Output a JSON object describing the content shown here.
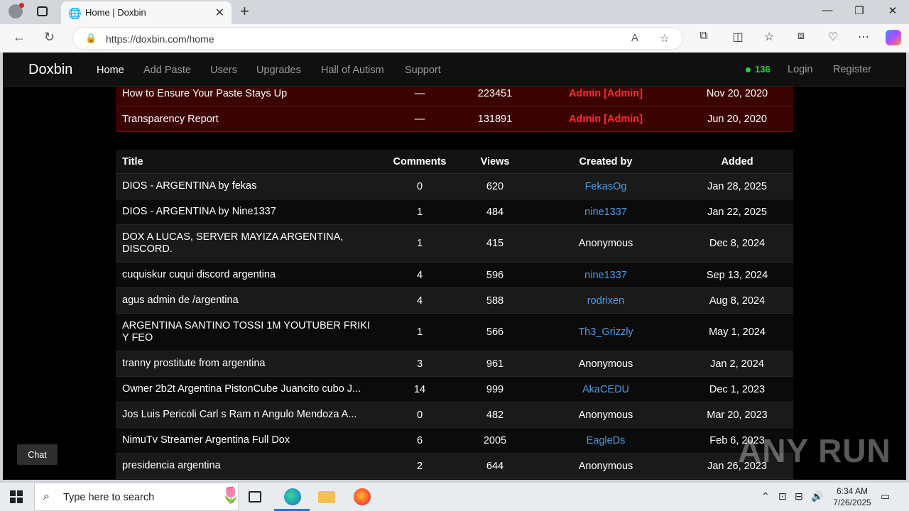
{
  "browser": {
    "tab_title": "Home | Doxbin",
    "url": "https://doxbin.com/home"
  },
  "site": {
    "brand": "Doxbin",
    "nav": [
      "Home",
      "Add Paste",
      "Users",
      "Upgrades",
      "Hall of Autism",
      "Support"
    ],
    "online_count": "136",
    "login": "Login",
    "register": "Register",
    "accent_color": "#29d13c",
    "pinned_bg": "#3c0303",
    "link_color": "#4c9be8"
  },
  "pinned": [
    {
      "title": "How to Ensure Your Paste Stays Up",
      "comments": "—",
      "views": "223451",
      "created_by": "Admin [Admin]",
      "added": "Nov 20, 2020"
    },
    {
      "title": "Transparency Report",
      "comments": "—",
      "views": "131891",
      "created_by": "Admin [Admin]",
      "added": "Jun 20, 2020"
    }
  ],
  "table": {
    "headers": {
      "title": "Title",
      "comments": "Comments",
      "views": "Views",
      "created_by": "Created by",
      "added": "Added"
    },
    "rows": [
      {
        "title": "DIOS - ARGENTINA by fekas",
        "comments": "0",
        "views": "620",
        "created_by": "FekasOg",
        "added": "Jan 28, 2025"
      },
      {
        "title": "DIOS - ARGENTINA by Nine1337",
        "comments": "1",
        "views": "484",
        "created_by": "nine1337",
        "added": "Jan 22, 2025"
      },
      {
        "title": "DOX A LUCAS, SERVER MAYIZA ARGENTINA, DISCORD.",
        "comments": "1",
        "views": "415",
        "created_by": "Anonymous",
        "added": "Dec 8, 2024"
      },
      {
        "title": "cuquiskur cuqui discord argentina",
        "comments": "4",
        "views": "596",
        "created_by": "nine1337",
        "added": "Sep 13, 2024"
      },
      {
        "title": "agus admin de /argentina",
        "comments": "4",
        "views": "588",
        "created_by": "rodrixen",
        "added": "Aug 8, 2024"
      },
      {
        "title": "ARGENTINA SANTINO TOSSI 1M YOUTUBER FRIKI Y FEO",
        "comments": "1",
        "views": "566",
        "created_by": "Th3_Grizzly",
        "added": "May 1, 2024"
      },
      {
        "title": "tranny prostitute from argentina",
        "comments": "3",
        "views": "961",
        "created_by": "Anonymous",
        "added": "Jan 2, 2024"
      },
      {
        "title": "Owner 2b2t Argentina PistonCube Juancito cubo J...",
        "comments": "14",
        "views": "999",
        "created_by": "AkaCEDU",
        "added": "Dec 1, 2023"
      },
      {
        "title": "Jos Luis Pericoli Carl s Ram n Angulo Mendoza A...",
        "comments": "0",
        "views": "482",
        "created_by": "Anonymous",
        "added": "Mar 20, 2023"
      },
      {
        "title": "NimuTv Streamer Argentina Full Dox",
        "comments": "6",
        "views": "2005",
        "created_by": "EagleDs",
        "added": "Feb 6, 2023"
      },
      {
        "title": "presidencia argentina",
        "comments": "2",
        "views": "644",
        "created_by": "Anonymous",
        "added": "Jan 26, 2023"
      }
    ]
  },
  "chat_label": "Chat",
  "watermark": "ANY RUN",
  "taskbar": {
    "search_placeholder": "Type here to search",
    "time": "6:34 AM",
    "date": "7/26/2025"
  }
}
